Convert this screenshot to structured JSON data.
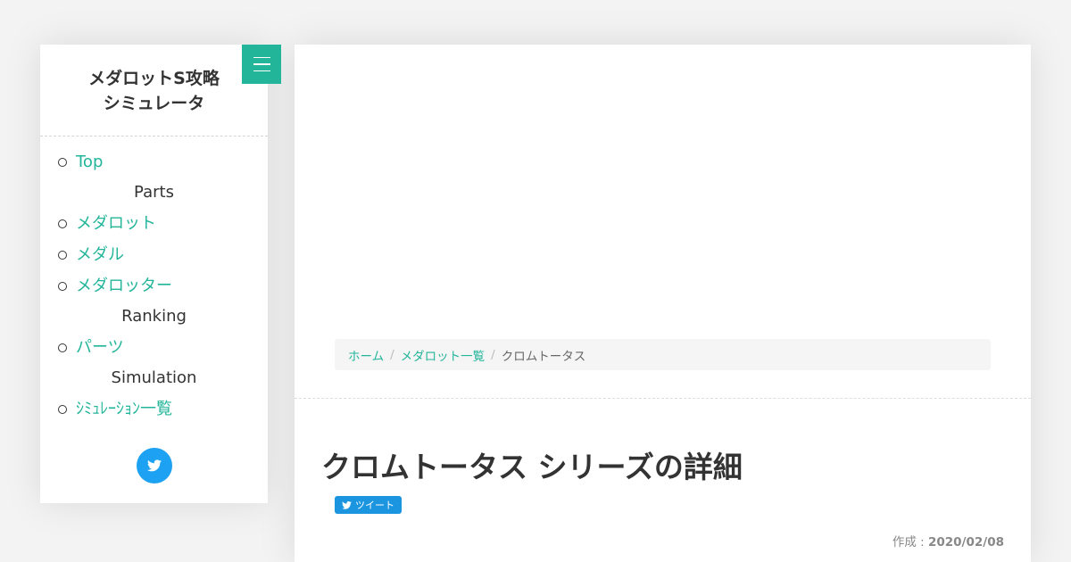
{
  "sidebar": {
    "site_title_line1": "メダロットS攻略",
    "site_title_line2": "シミュレータ",
    "nav": {
      "top": "Top",
      "parts_heading": "Parts",
      "medarot": "メダロット",
      "medal": "メダル",
      "medarotter": "メダロッター",
      "ranking_heading": "Ranking",
      "parts": "パーツ",
      "simulation_heading": "Simulation",
      "simulation_list": "ｼﾐｭﾚｰｼｮﾝ一覧"
    }
  },
  "breadcrumb": {
    "home": "ホーム",
    "list": "メダロット一覧",
    "current": "クロムトータス"
  },
  "article": {
    "title": "クロムトータス シリーズの詳細",
    "tweet_label": "ツイート",
    "created_label": "作成 : ",
    "created_date": "2020/02/08"
  },
  "colors": {
    "accent": "#22b59a",
    "twitter": "#1da1f2",
    "tweet_button": "#1b95e0"
  }
}
